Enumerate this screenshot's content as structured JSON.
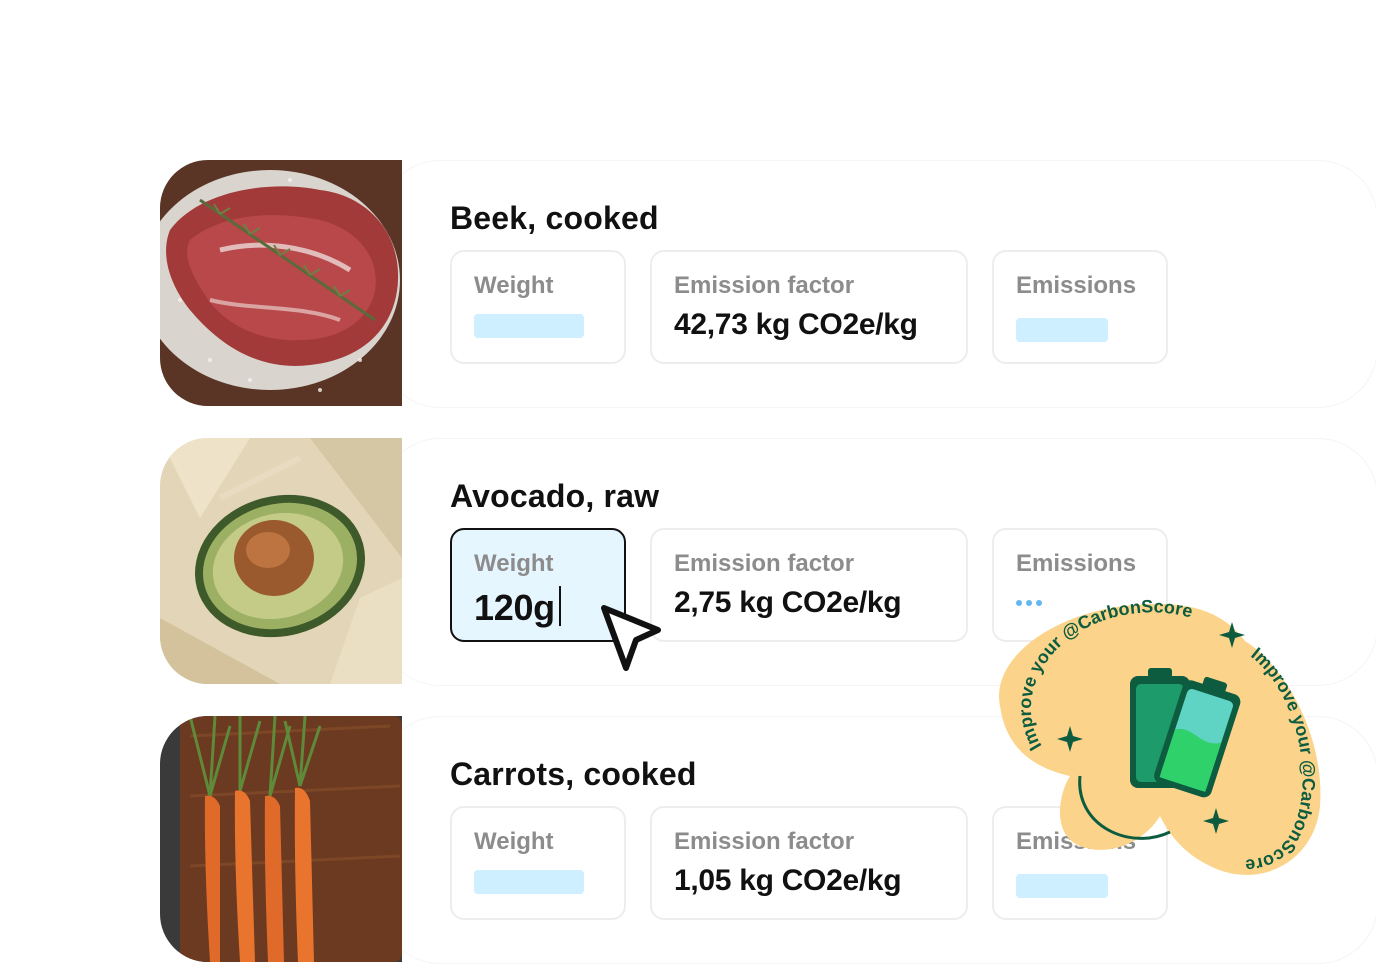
{
  "items": [
    {
      "name": "Beek, cooked",
      "image": "beef-steak-with-rosemary",
      "weight_label": "Weight",
      "factor_label": "Emission factor",
      "factor_value": "42,73 kg CO2e/kg",
      "emissions_label": "Emissions"
    },
    {
      "name": "Avocado, raw",
      "image": "halved-avocado-on-cloth",
      "weight_label": "Weight",
      "weight_value": "120g",
      "factor_label": "Emission factor",
      "factor_value": "2,75 kg CO2e/kg",
      "emissions_label": "Emissions"
    },
    {
      "name": "Carrots, cooked",
      "image": "carrots-on-cutting-board",
      "weight_label": "Weight",
      "factor_label": "Emission factor",
      "factor_value": "1,05 kg CO2e/kg",
      "emissions_label": "Emissions"
    }
  ],
  "sticker": {
    "text": "Improve your @CarbonScore",
    "icon": "battery-icon",
    "color": "#fbd38a"
  },
  "cursor": {
    "icon": "pointer-cursor-icon"
  },
  "colors": {
    "placeholder": "#cdefff",
    "active_field": "#e6f6ff",
    "label_gray": "#8c8c8c",
    "sticker_green": "#0d5c3f"
  }
}
